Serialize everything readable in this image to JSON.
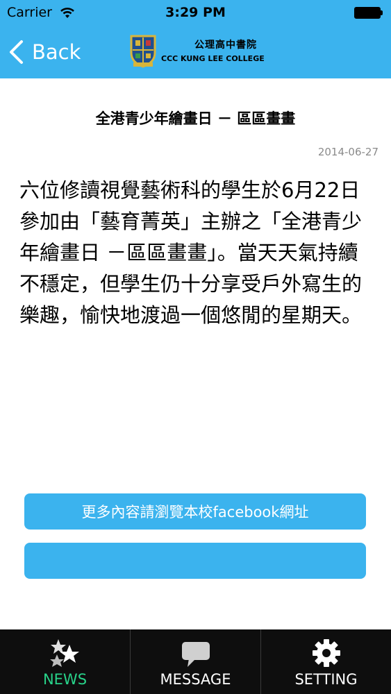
{
  "status_bar": {
    "carrier": "Carrier",
    "time": "3:29 PM",
    "icons": [
      "wifi-icon",
      "battery-icon"
    ]
  },
  "nav": {
    "back_label": "Back",
    "school_name_cn": "公理高中書院",
    "school_name_en": "CCC KUNG LEE COLLEGE",
    "icons": [
      "chevron-left-icon",
      "school-crest-icon"
    ]
  },
  "article": {
    "title": "全港青少年繪畫日 － 區區畫畫",
    "date": "2014-06-27",
    "body": "六位修讀視覺藝術科的學生於6月22日參加由「藝育菁英」主辦之「全港青少年繪畫日 －區區畫畫」。當天天氣持續不穩定，但學生仍十分享受戶外寫生的樂趣，愉快地渡過一個悠閒的星期天。"
  },
  "buttons": {
    "facebook_label": "更多內容請瀏覽本校facebook網址",
    "second_label": ""
  },
  "tabbar": {
    "tabs": [
      {
        "label": "NEWS",
        "icon": "stars-icon",
        "active": true
      },
      {
        "label": "MESSAGE",
        "icon": "speech-bubble-icon",
        "active": false
      },
      {
        "label": "SETTING",
        "icon": "gear-icon",
        "active": false
      }
    ]
  },
  "colors": {
    "accent": "#3bb3ee",
    "tab_active": "#28d38a",
    "tabbar_bg": "#0e0e0e",
    "date_gray": "#8a8a8a"
  }
}
